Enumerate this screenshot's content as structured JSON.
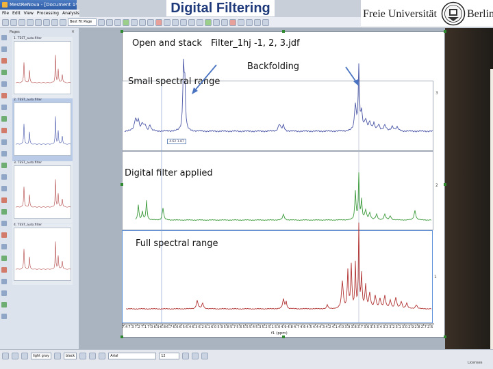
{
  "slide_title": "Digital Filtering",
  "window": {
    "title": "MestReNova - [Document 1*]"
  },
  "menu": [
    "File",
    "Edit",
    "View",
    "Processing",
    "Analysis",
    "A"
  ],
  "toolbar": {
    "layout_select": "Best Fit Page"
  },
  "logo": {
    "left_text": "Freie Universität",
    "right_text": "Berlin"
  },
  "pages_panel": {
    "header": "Pages",
    "close": "×",
    "thumbnails": [
      {
        "label": "1. TEST_auto.filter",
        "color": "#b04040"
      },
      {
        "label": "2. TEST_auto.filter",
        "color": "#4050a8"
      },
      {
        "label": "3. TEST_auto.filter",
        "color": "#b04040"
      },
      {
        "label": "4. TEST_auto.filter",
        "color": "#b04040"
      }
    ]
  },
  "annotations": {
    "open_and_stack": "Open and stack",
    "filter_file": "Filter_1hj -1, 2, 3.jdf",
    "backfolding": "Backfolding",
    "small_range": "Small spectral range",
    "filter_applied": "Digital filter applied",
    "full_range": "Full spectral range"
  },
  "spectra": {
    "frame_numbers": [
      "3",
      "2",
      "1"
    ],
    "peak_tag": "4.62  1.87",
    "x_ticks": [
      "7.4",
      "7.3",
      "7.2",
      "7.1",
      "7.0",
      "6.9",
      "6.8",
      "6.7",
      "6.6",
      "6.5",
      "6.4",
      "6.3",
      "6.2",
      "6.1",
      "6.0",
      "5.9",
      "5.8",
      "5.7",
      "5.6",
      "5.5",
      "5.4",
      "5.3",
      "5.2",
      "5.1",
      "5.0",
      "4.9",
      "4.8",
      "4.7",
      "4.6",
      "4.5",
      "4.4",
      "4.3",
      "4.2",
      "4.1",
      "4.0",
      "3.9",
      "3.8",
      "3.7",
      "3.6",
      "3.5",
      "3.4",
      "3.3",
      "3.2",
      "3.1",
      "3.0",
      "2.9",
      "2.8",
      "2.7",
      "2.6"
    ],
    "x_unit": "f1 (ppm)",
    "colors": {
      "top": "#4a56a6",
      "middle": "#3a9a3a",
      "bottom": "#b03030"
    }
  },
  "statusbar": {
    "color_select": "light gray",
    "line_select": "black",
    "font_select": "Arial",
    "size_select": "12",
    "licenses": "Licenses"
  }
}
